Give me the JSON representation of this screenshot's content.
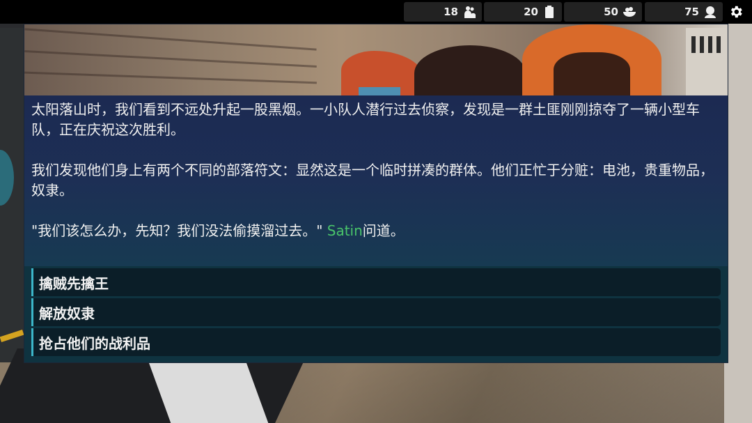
{
  "resources": [
    {
      "value": "18",
      "icon": "population-icon"
    },
    {
      "value": "20",
      "icon": "battery-icon"
    },
    {
      "value": "50",
      "icon": "food-bowl-icon"
    },
    {
      "value": "75",
      "icon": "morale-icon"
    }
  ],
  "event": {
    "paragraph1": "太阳落山时，我们看到不远处升起一股黑烟。一小队人潜行过去侦察，发现是一群土匪刚刚掠夺了一辆小型车队，正在庆祝这次胜利。",
    "paragraph2": "我们发现他们身上有两个不同的部落符文：显然这是一个临时拼凑的群体。他们正忙于分赃：电池，贵重物品，奴隶。",
    "quote": "\"我们该怎么办，先知？我们没法偷摸溜过去。\" ",
    "speaker": "Satin",
    "quote_suffix": "问道。",
    "speaker_color": "#49c46a"
  },
  "choices": [
    {
      "label": "擒贼先擒王"
    },
    {
      "label": "解放奴隶"
    },
    {
      "label": "抢占他们的战利品"
    }
  ]
}
